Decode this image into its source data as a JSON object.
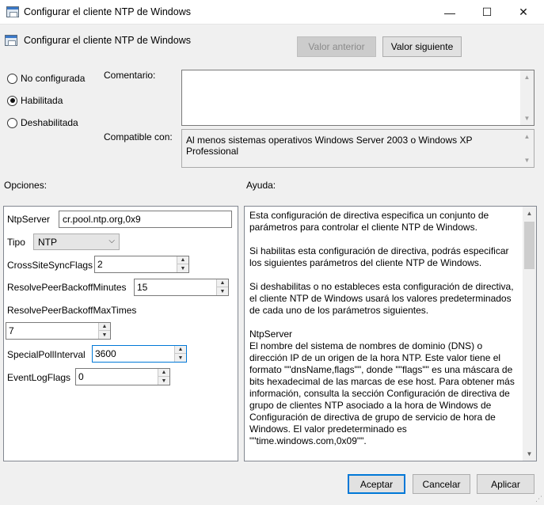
{
  "window": {
    "title": "Configurar el cliente NTP de Windows",
    "minimize_glyph": "—",
    "maximize_glyph": "☐",
    "close_glyph": "✕"
  },
  "header": {
    "policy_name": "Configurar el cliente NTP de Windows",
    "prev_label": "Valor anterior",
    "next_label": "Valor siguiente"
  },
  "state": {
    "options": [
      {
        "label": "No configurada",
        "selected": false
      },
      {
        "label": "Habilitada",
        "selected": true
      },
      {
        "label": "Deshabilitada",
        "selected": false
      }
    ]
  },
  "comment": {
    "label": "Comentario:",
    "value": ""
  },
  "supported": {
    "label": "Compatible con:",
    "value": "Al menos sistemas operativos Windows Server 2003 o Windows XP Professional"
  },
  "options_panel": {
    "title": "Opciones:",
    "ntpserver_label": "NtpServer",
    "ntpserver_value": "cr.pool.ntp.org,0x9",
    "tipo_label": "Tipo",
    "tipo_value": "NTP",
    "crosssite_label": "CrossSiteSyncFlags",
    "crosssite_value": "2",
    "backoff_minutes_label": "ResolvePeerBackoffMinutes",
    "backoff_minutes_value": "15",
    "backoff_max_label": "ResolvePeerBackoffMaxTimes",
    "backoff_max_value": "7",
    "special_poll_label": "SpecialPollInterval",
    "special_poll_value": "3600",
    "eventlog_label": "EventLogFlags",
    "eventlog_value": "0"
  },
  "help_panel": {
    "title": "Ayuda:",
    "paragraphs": [
      "Esta configuración de directiva especifica un conjunto de parámetros para controlar el cliente NTP de Windows.",
      "Si habilitas esta configuración de directiva, podrás especificar los siguientes parámetros del cliente NTP de Windows.",
      "Si deshabilitas o no estableces esta configuración de directiva, el cliente NTP de Windows usará los valores predeterminados de cada uno de los parámetros siguientes.",
      "NtpServer",
      "El nombre del sistema de nombres de dominio (DNS) o dirección IP de un origen de la hora NTP. Este valor tiene el formato \"\"dnsName,flags\"\", donde \"\"flags\"\" es una máscara de bits hexadecimal de las marcas de ese host. Para obtener más información, consulta la sección Configuración de directiva de grupo de clientes NTP asociado a la hora de Windows de Configuración de directiva de grupo de servicio de hora de Windows. El valor predeterminado es \"\"time.windows.com,0x09\"\".",
      "–"
    ]
  },
  "footer": {
    "ok_label": "Aceptar",
    "cancel_label": "Cancelar",
    "apply_label": "Aplicar"
  }
}
